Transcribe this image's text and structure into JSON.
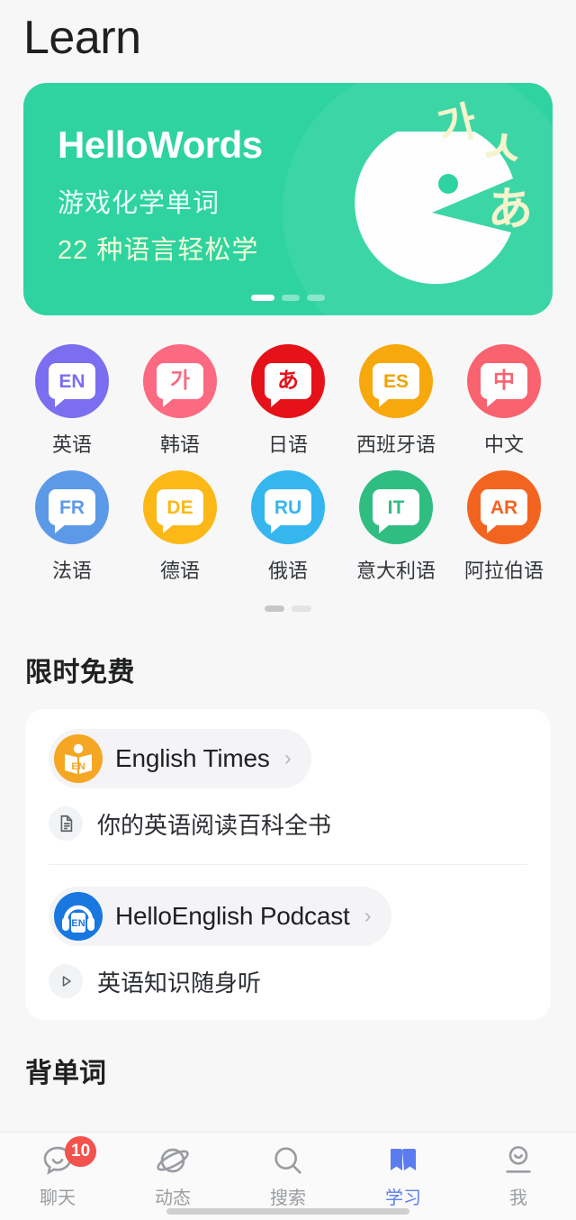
{
  "header": {
    "title": "Learn"
  },
  "banner": {
    "title": "HelloWords",
    "subtitle1": "游戏化学单词",
    "subtitle2": "22 种语言轻松学",
    "glyph_korean": "가",
    "glyph_symbol": "ㅅ",
    "glyph_japanese": "あ",
    "bg_color": "#2ed3a0",
    "dots": 3,
    "active_dot": 0
  },
  "languages": [
    {
      "code": "EN",
      "label": "英语",
      "color": "#7b6ef0",
      "text_color": "#7b6ef0"
    },
    {
      "code": "가",
      "label": "韩语",
      "color": "#fb6a81",
      "text_color": "#fb6a81"
    },
    {
      "code": "あ",
      "label": "日语",
      "color": "#e5121a",
      "text_color": "#e5121a"
    },
    {
      "code": "ES",
      "label": "西班牙语",
      "color": "#f7a80d",
      "text_color": "#f0a200"
    },
    {
      "code": "中",
      "label": "中文",
      "color": "#f8636f",
      "text_color": "#f8636f"
    },
    {
      "code": "FR",
      "label": "法语",
      "color": "#5c9ae8",
      "text_color": "#5c9ae8"
    },
    {
      "code": "DE",
      "label": "德语",
      "color": "#fbb817",
      "text_color": "#fbb817"
    },
    {
      "code": "RU",
      "label": "俄语",
      "color": "#35b6ef",
      "text_color": "#35b6ef"
    },
    {
      "code": "IT",
      "label": "意大利语",
      "color": "#2fbd82",
      "text_color": "#2fbd82"
    },
    {
      "code": "AR",
      "label": "阿拉伯语",
      "color": "#f36420",
      "text_color": "#f36420"
    }
  ],
  "lang_pager": {
    "dots": 2,
    "active_dot": 0
  },
  "free_section": {
    "title": "限时免费",
    "items": [
      {
        "name": "English Times",
        "icon": "book-en-icon",
        "icon_color": "#f5a623",
        "chevron": "›",
        "sub_icon": "document-icon",
        "sub_text": "你的英语阅读百科全书"
      },
      {
        "name": "HelloEnglish Podcast",
        "icon": "headphones-en-icon",
        "icon_color": "#1878e0",
        "chevron": "›",
        "sub_icon": "play-icon",
        "sub_text": "英语知识随身听"
      }
    ]
  },
  "next_section": {
    "title": "背单词"
  },
  "tabbar": {
    "accent": "#5b7cf0",
    "items": [
      {
        "label": "聊天",
        "icon": "chat-bubble-icon",
        "badge": "10",
        "active": false
      },
      {
        "label": "动态",
        "icon": "planet-icon",
        "badge": "",
        "active": false
      },
      {
        "label": "搜索",
        "icon": "search-icon",
        "badge": "",
        "active": false
      },
      {
        "label": "学习",
        "icon": "book-icon",
        "badge": "",
        "active": true
      },
      {
        "label": "我",
        "icon": "person-icon",
        "badge": "",
        "active": false
      }
    ]
  }
}
